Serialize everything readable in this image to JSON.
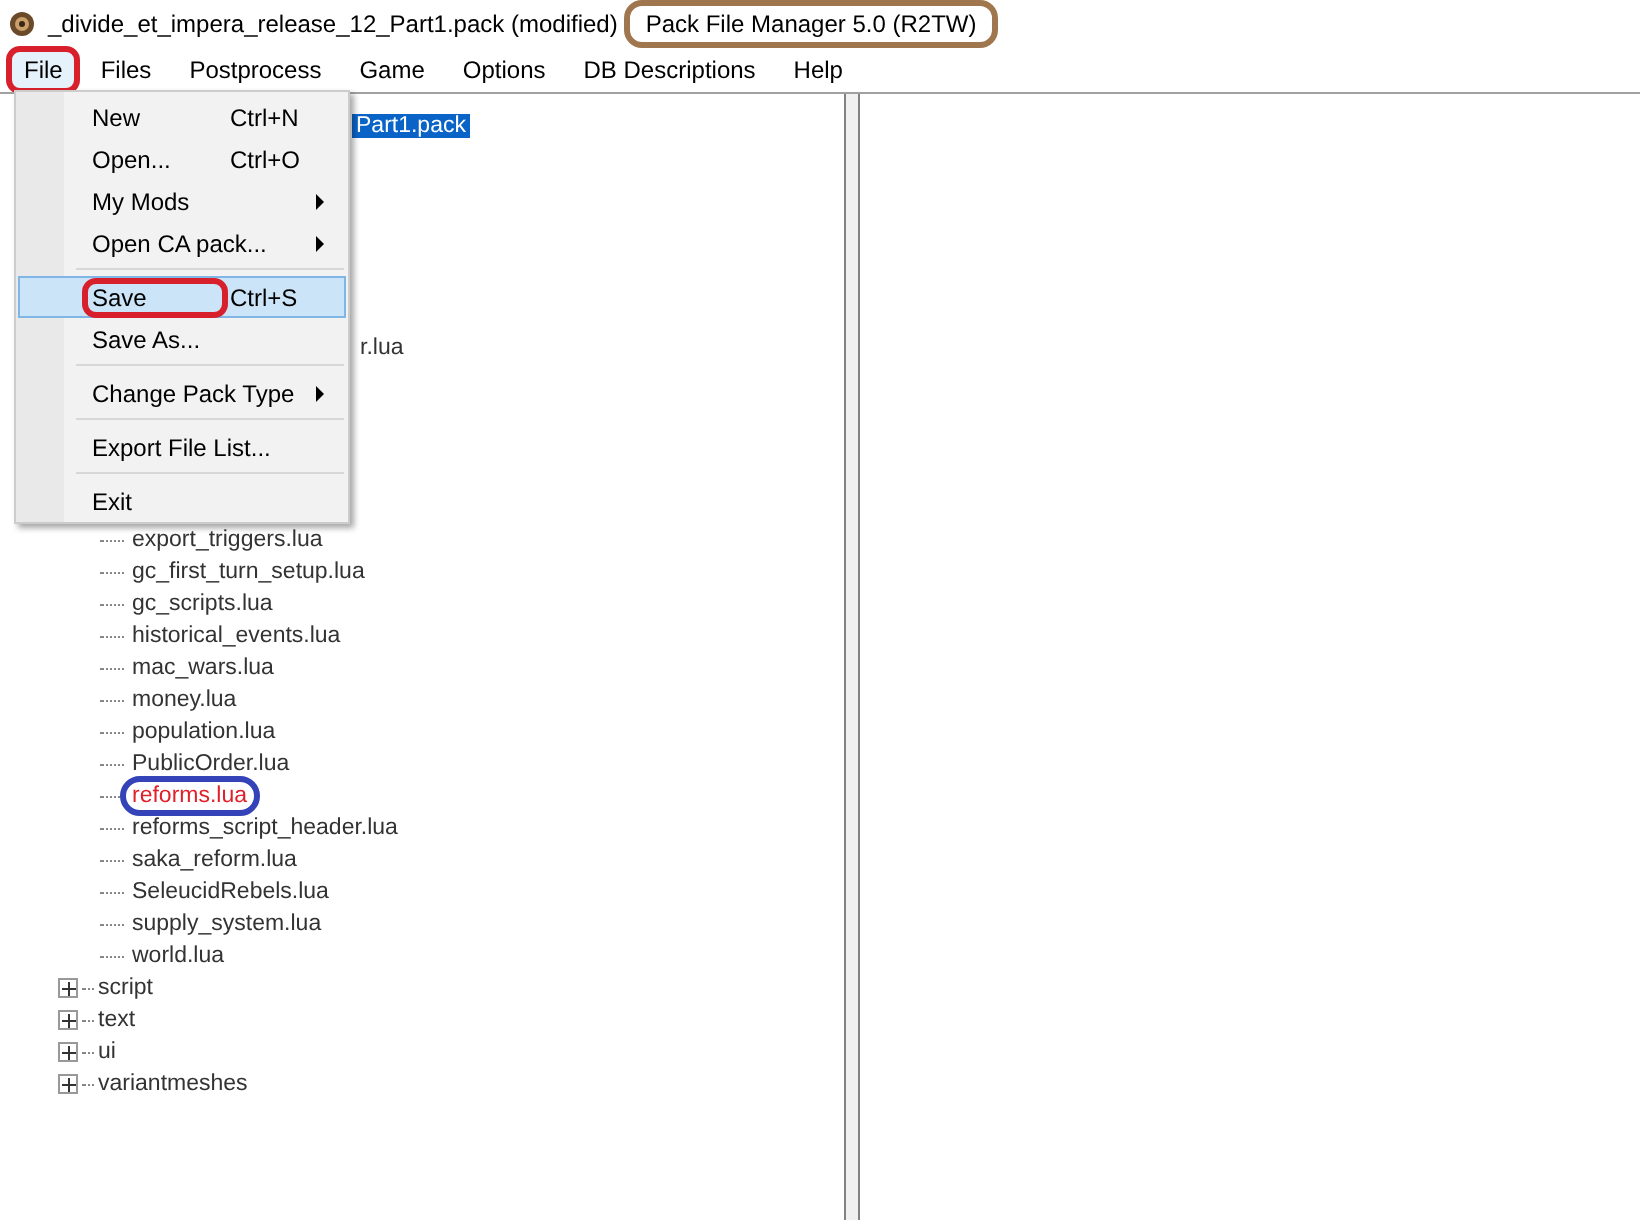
{
  "window": {
    "title": "_divide_et_impera_release_12_Part1.pack (modified)",
    "app_name": "Pack File Manager 5.0 (R2TW)",
    "app_name_outlined": true
  },
  "menu_bar": [
    {
      "label": "File",
      "selected": true,
      "outlined": true
    },
    {
      "label": "Files",
      "selected": false,
      "outlined": false
    },
    {
      "label": "Postprocess",
      "selected": false,
      "outlined": false
    },
    {
      "label": "Game",
      "selected": false,
      "outlined": false
    },
    {
      "label": "Options",
      "selected": false,
      "outlined": false
    },
    {
      "label": "DB Descriptions",
      "selected": false,
      "outlined": false
    },
    {
      "label": "Help",
      "selected": false,
      "outlined": false
    }
  ],
  "file_menu": [
    {
      "kind": "item",
      "label": "New",
      "shortcut": "Ctrl+N",
      "selected": false,
      "outlined": false
    },
    {
      "kind": "item",
      "label": "Open...",
      "shortcut": "Ctrl+O",
      "selected": false,
      "outlined": false
    },
    {
      "kind": "submenu",
      "label": "My Mods",
      "selected": false,
      "outlined": false
    },
    {
      "kind": "submenu",
      "label": "Open CA pack...",
      "selected": false,
      "outlined": false
    },
    {
      "kind": "separator"
    },
    {
      "kind": "item",
      "label": "Save",
      "shortcut": "Ctrl+S",
      "selected": true,
      "outlined": true
    },
    {
      "kind": "item",
      "label": "Save As...",
      "selected": false,
      "outlined": false
    },
    {
      "kind": "separator"
    },
    {
      "kind": "submenu",
      "label": "Change Pack Type",
      "selected": false,
      "outlined": false
    },
    {
      "kind": "separator"
    },
    {
      "kind": "item",
      "label": "Export File List...",
      "selected": false,
      "outlined": false
    },
    {
      "kind": "separator"
    },
    {
      "kind": "item",
      "label": "Exit",
      "selected": false,
      "outlined": false
    }
  ],
  "tree": {
    "root": {
      "label": "Part1.pack",
      "selected": true
    },
    "partial_row": "r.lua",
    "files": [
      {
        "label": "export_triggers.lua",
        "modified": false,
        "outlined": false
      },
      {
        "label": "gc_first_turn_setup.lua",
        "modified": false,
        "outlined": false
      },
      {
        "label": "gc_scripts.lua",
        "modified": false,
        "outlined": false
      },
      {
        "label": "historical_events.lua",
        "modified": false,
        "outlined": false
      },
      {
        "label": "mac_wars.lua",
        "modified": false,
        "outlined": false
      },
      {
        "label": "money.lua",
        "modified": false,
        "outlined": false
      },
      {
        "label": "population.lua",
        "modified": false,
        "outlined": false
      },
      {
        "label": "PublicOrder.lua",
        "modified": false,
        "outlined": false
      },
      {
        "label": "reforms.lua",
        "modified": true,
        "outlined": true
      },
      {
        "label": "reforms_script_header.lua",
        "modified": false,
        "outlined": false
      },
      {
        "label": "saka_reform.lua",
        "modified": false,
        "outlined": false
      },
      {
        "label": "SeleucidRebels.lua",
        "modified": false,
        "outlined": false
      },
      {
        "label": "supply_system.lua",
        "modified": false,
        "outlined": false
      },
      {
        "label": "world.lua",
        "modified": false,
        "outlined": false
      }
    ],
    "folders": [
      {
        "label": "script",
        "expanded": false
      },
      {
        "label": "text",
        "expanded": false
      },
      {
        "label": "ui",
        "expanded": false
      },
      {
        "label": "variantmeshes",
        "expanded": false
      }
    ]
  }
}
